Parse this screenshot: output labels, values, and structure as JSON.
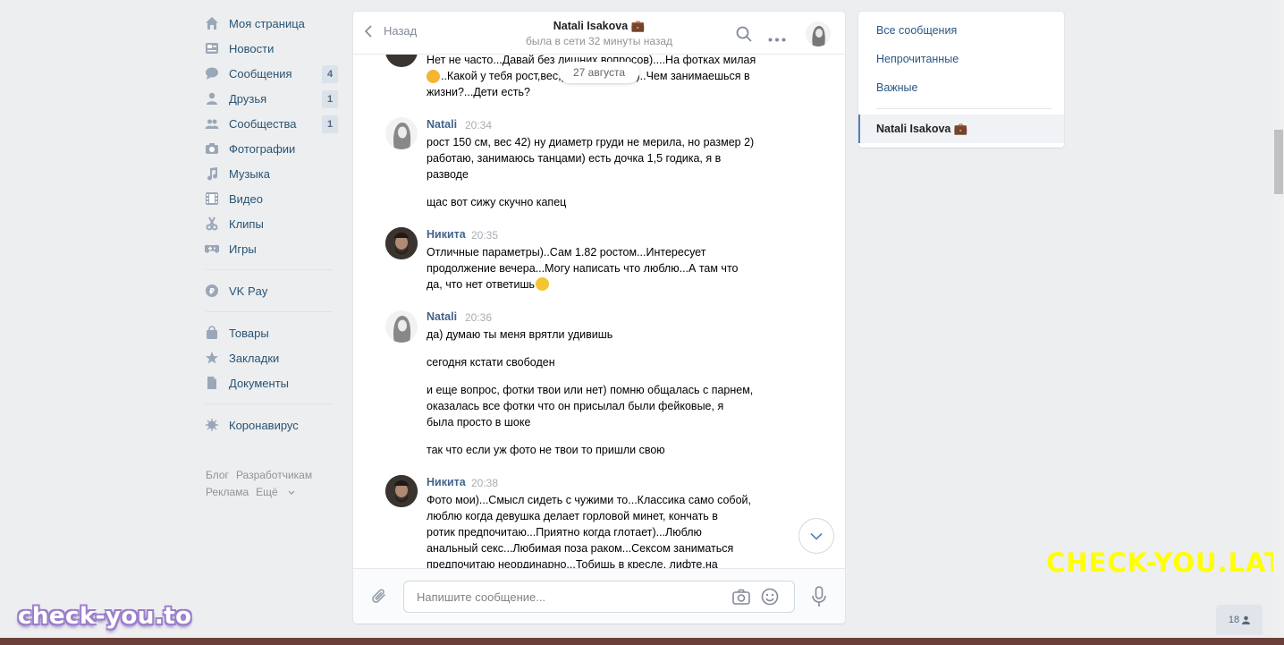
{
  "nav": {
    "items": [
      {
        "label": "Моя страница",
        "icon": "home-icon"
      },
      {
        "label": "Новости",
        "icon": "news-icon"
      },
      {
        "label": "Сообщения",
        "icon": "messages-icon",
        "count": "4"
      },
      {
        "label": "Друзья",
        "icon": "friends-icon",
        "count": "1"
      },
      {
        "label": "Сообщества",
        "icon": "communities-icon",
        "count": "1"
      },
      {
        "label": "Фотографии",
        "icon": "camera-icon"
      },
      {
        "label": "Музыка",
        "icon": "music-icon"
      },
      {
        "label": "Видео",
        "icon": "video-icon"
      },
      {
        "label": "Клипы",
        "icon": "clips-icon"
      },
      {
        "label": "Игры",
        "icon": "gamepad-icon"
      }
    ],
    "vkpay": "VK Pay",
    "shop": [
      {
        "label": "Товары",
        "icon": "bag-icon"
      },
      {
        "label": "Закладки",
        "icon": "star-icon"
      },
      {
        "label": "Документы",
        "icon": "document-icon"
      }
    ],
    "corona": "Коронавирус"
  },
  "footer": {
    "blog": "Блог",
    "dev": "Разработчикам",
    "ads": "Реклама",
    "more": "Ещё"
  },
  "chat": {
    "back_label": "Назад",
    "peer_name": "Natali Isakova 💼",
    "peer_status": "была в сети 32 минуты назад",
    "date_divider": "27 августа",
    "input_placeholder": "Напишите сообщение...",
    "messages": {
      "m0_l1": "Нет не часто...Давай без лишних вопросов)....На фотках милая",
      "m0_l2": "..Какой у тебя рост,вес,размер груди?)..Чем занимаешься в",
      "m0_l3": "жизни?...Дети есть?",
      "m1_author": "Natali",
      "m1_time": "20:34",
      "m1_l1": "рост 150 см, вес 42) ну диаметр груди не мерила, но размер 2)",
      "m1_l2": "работаю, занимаюсь танцами) есть дочка 1,5 годика, я в",
      "m1_l3": "разводе",
      "m1_l4": "щас вот сижу скучно капец",
      "m2_author": "Никита",
      "m2_time": "20:35",
      "m2_l1": "Отличные параметры)..Сам 1.82 ростом...Интересует",
      "m2_l2": "продолжение вечера...Могу написать что люблю...А там что",
      "m2_l3": "да, что нет ответишь",
      "m3_author": "Natali",
      "m3_time": "20:36",
      "m3_l1": "да) думаю ты меня врятли удивишь",
      "m3_l2": "сегодня кстати свободен",
      "m3_l3": "и еще вопрос, фотки твои или нет) помню общалась с парнем,",
      "m3_l4": "оказалась все фотки что он присылал были фейковые, я",
      "m3_l5": "была просто в шоке",
      "m3_l6": "так что если уж фото не твои то пришли свою",
      "m4_author": "Никита",
      "m4_time": "20:38",
      "m4_l1": "Фото мои)...Смысл сидеть с чужими то...Классика само собой,",
      "m4_l2": "люблю когда девушка делает горловой минет, кончать в",
      "m4_l3": "ротик предпочитаю...Приятно когда глотает)...Люблю",
      "m4_l4": "анальный секс...Любимая поза раком...Сексом заниматься",
      "m4_l5": "предпочитаю неординарно...Тобишь в кресле, лифте,на"
    }
  },
  "right_panel": {
    "all": "Все сообщения",
    "unread": "Непрочитанные",
    "important": "Важные",
    "conversation": "Natali Isakova 💼"
  },
  "watermarks": {
    "left": "check-you.to",
    "right": "CHECK-YOU.LAT"
  },
  "online_count": "18",
  "colors": {
    "link": "#2a5885",
    "accent": "#5181b8",
    "background": "#edeef0"
  }
}
